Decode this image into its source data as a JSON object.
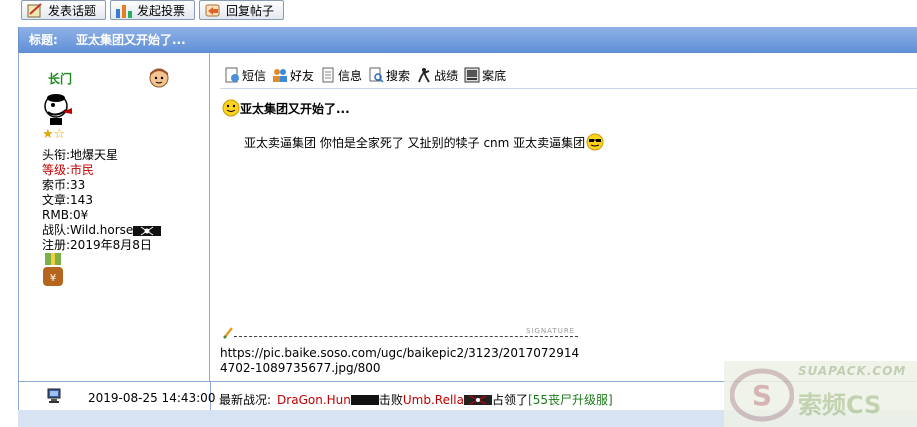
{
  "toolbar": {
    "new_topic": "发表话题",
    "new_poll": "发起投票",
    "reply": "回复帖子"
  },
  "thread": {
    "title_label": "标题:",
    "title": "亚太集团又开始了..."
  },
  "user": {
    "name": "长门",
    "fields": [
      {
        "label": "头衔:",
        "value": "地爆天星"
      },
      {
        "label": "等级:",
        "value": "市民"
      },
      {
        "label": "索币:",
        "value": "33"
      },
      {
        "label": "文章:",
        "value": "143"
      },
      {
        "label": "RMB:",
        "value": "0¥"
      },
      {
        "label": "战队:",
        "value": "Wild.horse"
      },
      {
        "label": "注册:",
        "value": "2019年8月8日"
      }
    ]
  },
  "actions": [
    "短信",
    "好友",
    "信息",
    "搜索",
    "战绩",
    "案底"
  ],
  "post": {
    "title": "亚太集团又开始了...",
    "body": "亚太卖逼集团 你怕是全家死了 又扯别的犊子 cnm 亚太卖逼集团"
  },
  "signature": {
    "label": "SIGNATURE",
    "text": "https://pic.baike.soso.com/ugc/baikepic2/3123/20170729144702-1089735677.jpg/800"
  },
  "footer": {
    "datetime": "2019-08-25 14:43:00",
    "news_label": "最新战况:",
    "player1": "DraGon.Hun",
    "action": "击败",
    "player2": "Umb.Rella",
    "action2": "占领了",
    "location": "[55丧尸升级服]"
  },
  "watermark": {
    "text": "SUAPACK.COM",
    "text2": "索频CS"
  },
  "colors": {
    "title_bar": "#6f9be0",
    "border": "#8fa9d6",
    "username": "#1a8a1a",
    "level": "#c00000",
    "player": "#c00000",
    "location": "#1a7a1a"
  }
}
